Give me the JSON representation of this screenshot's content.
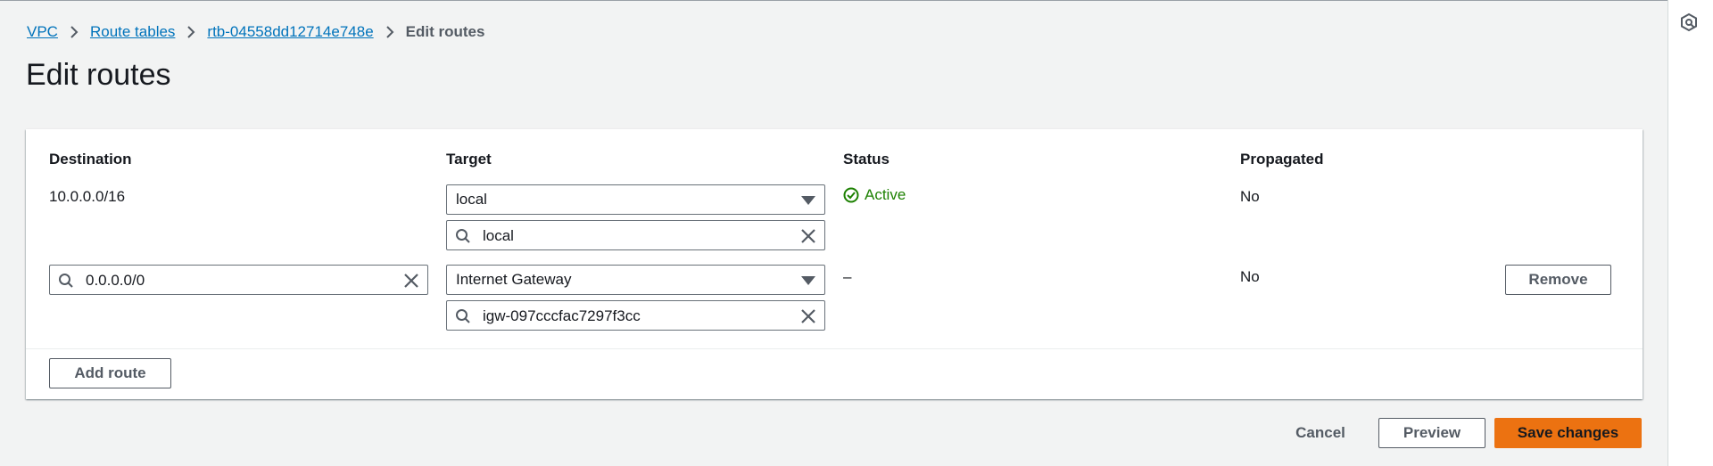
{
  "breadcrumb": {
    "items": [
      "VPC",
      "Route tables",
      "rtb-04558dd12714e748e"
    ],
    "current": "Edit routes"
  },
  "page": {
    "title": "Edit routes"
  },
  "table": {
    "headers": {
      "destination": "Destination",
      "target": "Target",
      "status": "Status",
      "propagated": "Propagated"
    },
    "rows": [
      {
        "destination": "10.0.0.0/16",
        "target_type": "local",
        "target_value": "local",
        "status": "Active",
        "propagated": "No"
      },
      {
        "destination": "0.0.0.0/0",
        "target_type": "Internet Gateway",
        "target_value": "igw-097cccfac7297f3cc",
        "status": "–",
        "propagated": "No",
        "remove_label": "Remove"
      }
    ],
    "add_route_label": "Add route"
  },
  "footer": {
    "cancel_label": "Cancel",
    "preview_label": "Preview",
    "save_label": "Save changes"
  },
  "colors": {
    "link": "#0073bb",
    "status_active": "#1d8102",
    "primary_button": "#ec7211"
  },
  "icons": {
    "rail": "settings-hexagon-icon",
    "search": "search-icon",
    "clear": "close-icon",
    "dropdown": "caret-down-icon",
    "status": "check-circle-icon",
    "separator": "chevron-right-icon"
  }
}
